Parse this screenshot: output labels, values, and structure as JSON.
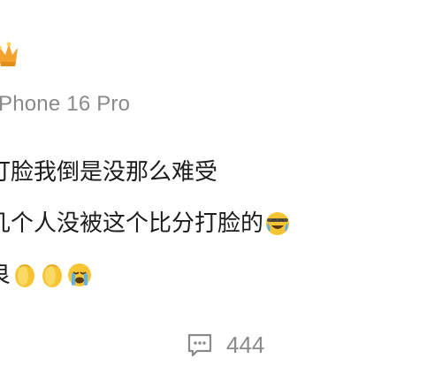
{
  "post": {
    "device": "Phone 16 Pro",
    "comment_lines": [
      "打脸我倒是没那么难受",
      "几个人没被这个比分打脸的",
      "良"
    ],
    "footer": {
      "comment_count": "444"
    }
  },
  "icons": {
    "badge": "crown-icon",
    "line2_end": "laugh-cry-emoji",
    "line3": [
      "clap-emoji",
      "clap-emoji",
      "crying-emoji"
    ],
    "footer": "comment-bubble-icon"
  },
  "colors": {
    "text_primary": "#1c1c1c",
    "text_secondary": "#8a8a8a",
    "emoji_yellow": "#f6c533",
    "crown_orange": "#f2a22f"
  }
}
